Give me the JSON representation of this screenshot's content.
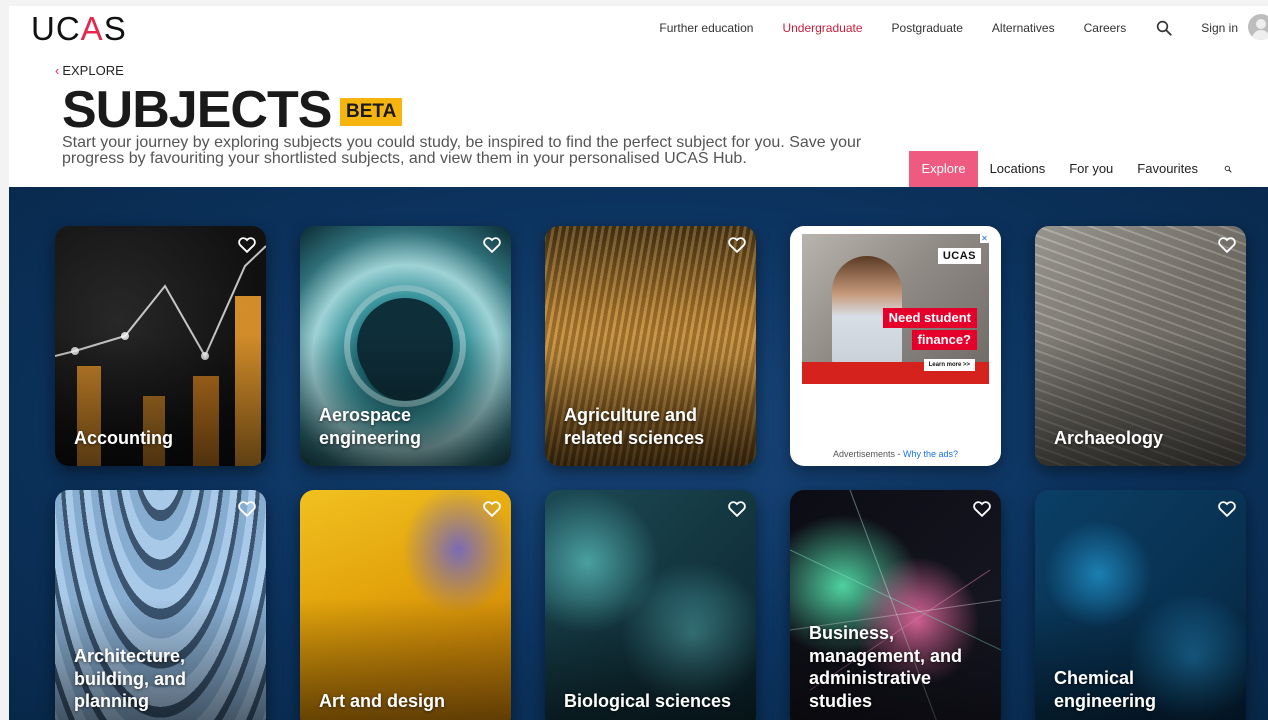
{
  "brand": {
    "logo_left": "UC",
    "logo_accent": "A",
    "logo_right": "S"
  },
  "topnav": {
    "items": [
      {
        "label": "Further education",
        "active": false
      },
      {
        "label": "Undergraduate",
        "active": true
      },
      {
        "label": "Postgraduate",
        "active": false
      },
      {
        "label": "Alternatives",
        "active": false
      },
      {
        "label": "Careers",
        "active": false
      }
    ],
    "search_icon": "search-icon",
    "signin": "Sign in"
  },
  "breadcrumb": {
    "label": "EXPLORE"
  },
  "page": {
    "title": "SUBJECTS",
    "badge": "BETA",
    "intro_line1": "Start your journey by exploring subjects you could study, be inspired to find the perfect subject for you. Save your",
    "intro_line2": "progress by favouriting your shortlisted subjects, and view them in your personalised UCAS Hub."
  },
  "subnav": {
    "tabs": [
      {
        "label": "Explore",
        "active": true
      },
      {
        "label": "Locations",
        "active": false
      },
      {
        "label": "For you",
        "active": false
      },
      {
        "label": "Favourites",
        "active": false
      }
    ]
  },
  "subjects": [
    {
      "label": "Accounting",
      "theme": "accounting"
    },
    {
      "label": "Aerospace engineering",
      "theme": "aero"
    },
    {
      "label": "Agriculture and related sciences",
      "theme": "agri"
    },
    {
      "label": "Archaeology",
      "theme": "arch"
    },
    {
      "label": "Architecture, building, and planning",
      "theme": "architecture"
    },
    {
      "label": "Art and design",
      "theme": "art"
    },
    {
      "label": "Biological sciences",
      "theme": "bio"
    },
    {
      "label": "Business, management, and administrative studies",
      "theme": "business"
    },
    {
      "label": "Chemical engineering",
      "theme": "chem"
    }
  ],
  "ad": {
    "logo": "UCAS",
    "line1": "Need student",
    "line2": "finance?",
    "cta": "Learn more >>",
    "footer_text": "Advertisements - ",
    "footer_link": "Why the ads?"
  },
  "colors": {
    "accent": "#e6264b",
    "explore_tab": "#ef5b80",
    "beta_badge": "#f5b50e",
    "grid_bg": "#0c335f"
  }
}
